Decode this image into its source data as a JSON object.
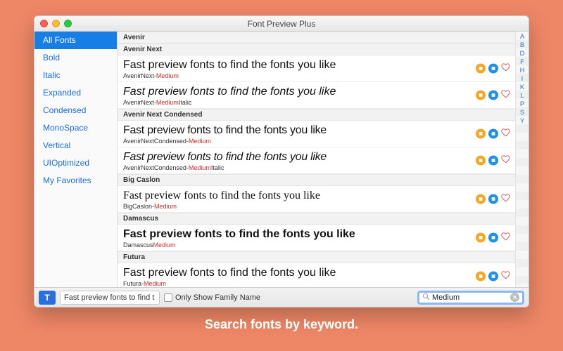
{
  "window": {
    "title": "Font Preview Plus"
  },
  "sidebar": {
    "items": [
      {
        "label": "All Fonts",
        "selected": true
      },
      {
        "label": "Bold"
      },
      {
        "label": "Italic"
      },
      {
        "label": "Expanded"
      },
      {
        "label": "Condensed"
      },
      {
        "label": "MonoSpace"
      },
      {
        "label": "Vertical"
      },
      {
        "label": "UIOptimized"
      },
      {
        "label": "My Favorites"
      }
    ]
  },
  "sample_text": "Fast preview fonts to find the fonts you like",
  "groups": [
    {
      "header": "Avenir",
      "rows": []
    },
    {
      "header": "Avenir Next",
      "rows": [
        {
          "class": "ff-avenir",
          "name_pre": "AvenirNext-",
          "name_hl": "Medium",
          "name_post": ""
        },
        {
          "class": "ff-avenir-it",
          "name_pre": "AvenirNext-",
          "name_hl": "Medium",
          "name_post": "Italic"
        }
      ]
    },
    {
      "header": "Avenir Next Condensed",
      "rows": [
        {
          "class": "ff-avenir-cond",
          "name_pre": "AvenirNextCondensed-",
          "name_hl": "Medium",
          "name_post": ""
        },
        {
          "class": "ff-avenir-cond-it",
          "name_pre": "AvenirNextCondensed-",
          "name_hl": "Medium",
          "name_post": "Italic"
        }
      ]
    },
    {
      "header": "Big Caslon",
      "rows": [
        {
          "class": "ff-caslon",
          "name_pre": "BigCaslon-",
          "name_hl": "Medium",
          "name_post": ""
        }
      ]
    },
    {
      "header": "Damascus",
      "rows": [
        {
          "class": "ff-damascus",
          "name_pre": "Damascus",
          "name_hl": "Medium",
          "name_post": ""
        }
      ]
    },
    {
      "header": "Futura",
      "rows": [
        {
          "class": "ff-futura",
          "name_pre": "Futura-",
          "name_hl": "Medium",
          "name_post": ""
        },
        {
          "class": "ff-futura-it",
          "name_pre": "",
          "name_hl": "",
          "name_post": "",
          "no_label": true
        }
      ]
    }
  ],
  "index_letters": [
    "A",
    "B",
    "D",
    "F",
    "H",
    "I",
    "K",
    "L",
    "P",
    "S",
    "Y"
  ],
  "toolbar": {
    "text_button": "T",
    "preview_value": "Fast preview fonts to find t",
    "only_family_label": "Only Show Family Name",
    "search_value": "Medium"
  },
  "caption": "Search fonts by keyword."
}
